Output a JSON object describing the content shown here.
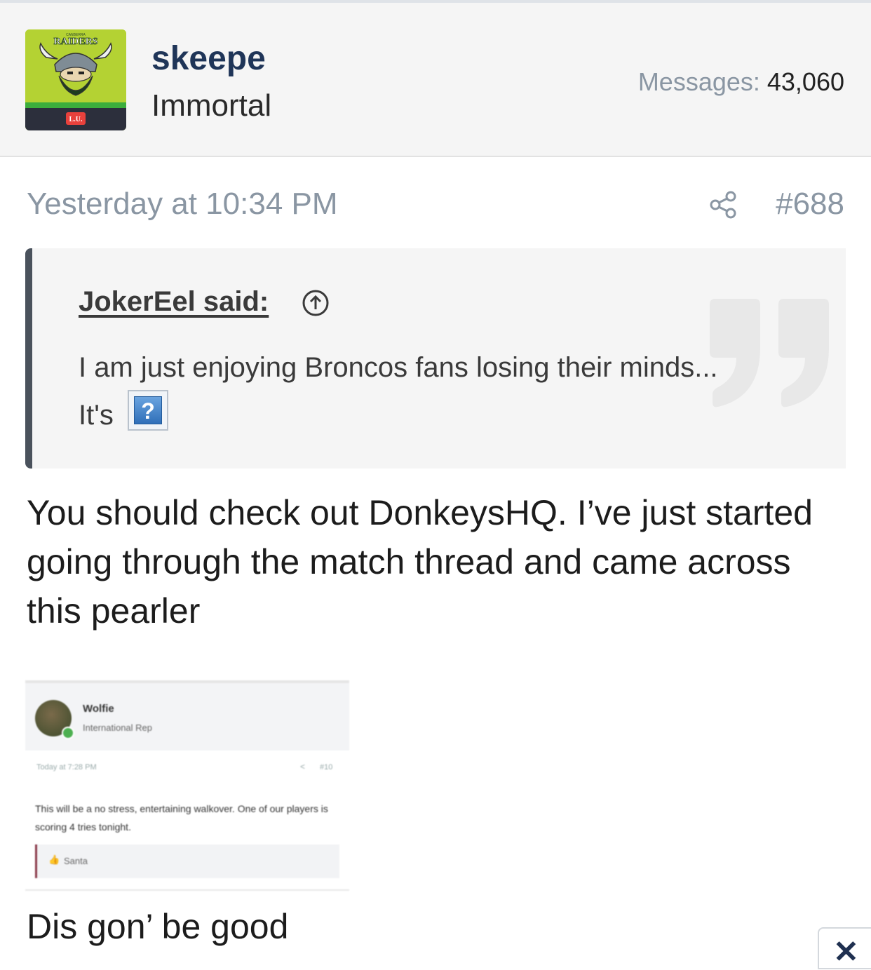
{
  "user": {
    "name": "skeepe",
    "title": "Immortal",
    "messages_label": "Messages:",
    "messages_count": "43,060",
    "avatar_text_top": "CANBERRA",
    "avatar_text_main": "RAIDERS",
    "avatar_text_badge": "L.U."
  },
  "post": {
    "date": "Yesterday at 10:34 PM",
    "number": "#688",
    "body": "You should check out DonkeysHQ. I’ve just started going through the match thread and came across this pearler",
    "closing": "Dis gon’ be good"
  },
  "quote": {
    "author": "JokerEel said:",
    "text_line1": "I am just enjoying Broncos fans losing their minds...",
    "text_line2": "It's",
    "emoji_glyph": "?"
  },
  "embed": {
    "username": "Wolfie",
    "usertitle": "International Rep",
    "date": "Today at 7:28 PM",
    "post_number": "#10",
    "text": "This will be a no stress, entertaining walkover. One of our players is scoring 4 tries tonight.",
    "quote_user": "Santa"
  },
  "close_glyph": "✕",
  "colors": {
    "username": "#1f3558",
    "muted": "#8a96a3",
    "quote_bar": "#4a525c",
    "avatar_green": "#b4d233"
  },
  "icons": [
    "share-icon",
    "arrow-up-circle-icon",
    "quote-mark-icon",
    "close-icon"
  ]
}
